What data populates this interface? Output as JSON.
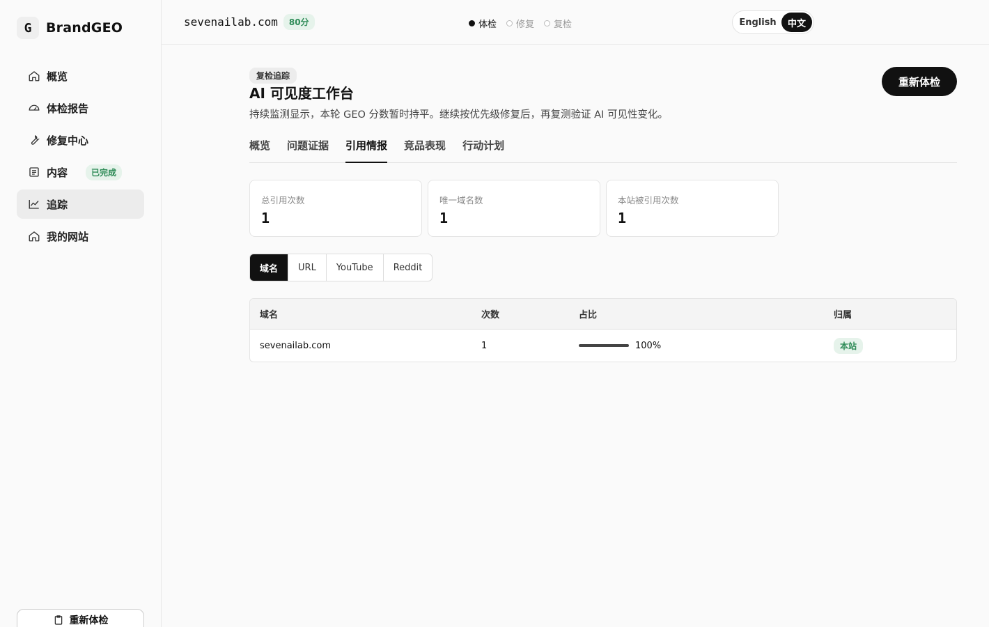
{
  "brand": {
    "logo_letter": "G",
    "name": "BrandGEO"
  },
  "sidebar": {
    "items": [
      {
        "label": "概览",
        "icon": "home-icon"
      },
      {
        "label": "体检报告",
        "icon": "gauge-icon"
      },
      {
        "label": "修复中心",
        "icon": "wrench-icon"
      },
      {
        "label": "内容",
        "icon": "document-icon",
        "badge": "已完成"
      },
      {
        "label": "追踪",
        "icon": "chart-line-icon",
        "active": true
      },
      {
        "label": "我的网站",
        "icon": "home-icon"
      }
    ],
    "bottom_button": "重新体检"
  },
  "topbar": {
    "site": "sevenailab.com",
    "score": "80分",
    "steps": [
      {
        "label": "体检",
        "current": true
      },
      {
        "label": "修复",
        "current": false
      },
      {
        "label": "复检",
        "current": false
      }
    ],
    "lang": {
      "en": "English",
      "zh": "中文",
      "selected": "中文"
    }
  },
  "page": {
    "chip": "复检追踪",
    "title": "AI 可见度工作台",
    "subtitle": "持续监测显示，本轮 GEO 分数暂时持平。继续按优先级修复后，再复测验证 AI 可见性变化。",
    "primary_button": "重新体检"
  },
  "tabs": [
    "概览",
    "问题证据",
    "引用情报",
    "竞品表现",
    "行动计划"
  ],
  "active_tab": "引用情报",
  "stats": [
    {
      "label": "总引用次数",
      "value": "1"
    },
    {
      "label": "唯一域名数",
      "value": "1"
    },
    {
      "label": "本站被引用次数",
      "value": "1"
    }
  ],
  "segments": [
    "域名",
    "URL",
    "YouTube",
    "Reddit"
  ],
  "active_segment": "域名",
  "table": {
    "headers": [
      "域名",
      "次数",
      "占比",
      "归属"
    ],
    "rows": [
      {
        "domain": "sevenailab.com",
        "count": "1",
        "share_label": "100%",
        "share": 1.0,
        "owner": "本站"
      }
    ]
  },
  "colors": {
    "accent": "#111111",
    "success_bg": "#e6f3eb",
    "success_text": "#2e8b57"
  }
}
